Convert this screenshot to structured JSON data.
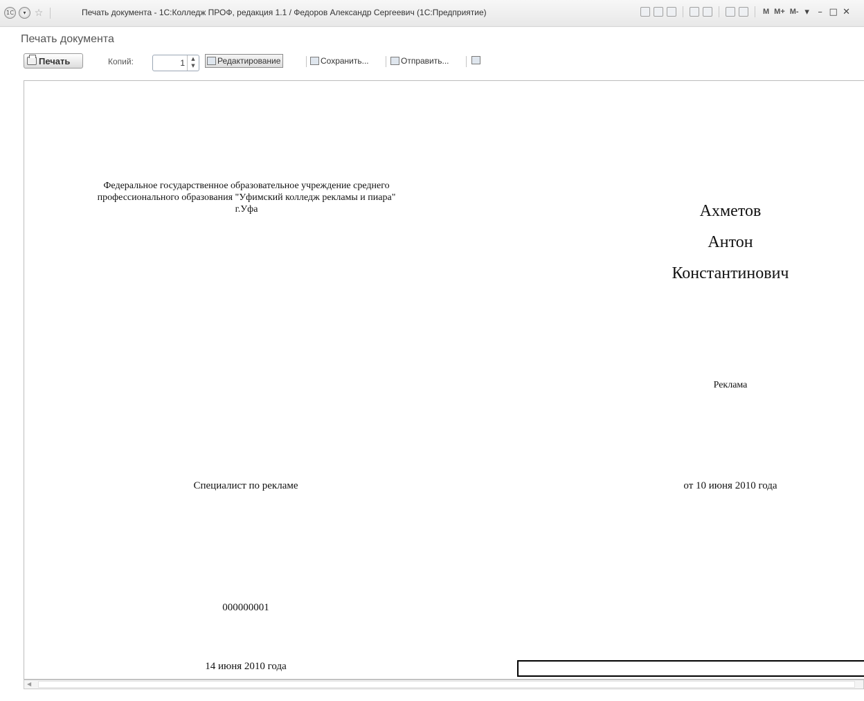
{
  "window": {
    "title": "Печать документа - 1С:Колледж ПРОФ, редакция 1.1 / Федоров Александр Сергеевич  (1С:Предприятие)",
    "app_icon": "1c-logo-icon",
    "menu_icon": "chevron-down-icon",
    "favorite_icon": "star-icon",
    "memory_buttons": [
      "M",
      "M+",
      "M-"
    ],
    "minimize": "–",
    "maximize": "□",
    "close": "✕"
  },
  "form": {
    "title": "Печать документа"
  },
  "toolbar": {
    "print_label": "Печать",
    "copies_label": "Копий:",
    "copies_value": "1",
    "edit_label": "Редактирование",
    "save_label": "Сохранить...",
    "send_label": "Отправить...",
    "preview_icon": "page-preview-icon"
  },
  "document": {
    "organization_line1": "Федеральное государственное образовательное учреждение среднего",
    "organization_line2": "профессионального образования \"Уфимский колледж рекламы и пиара\"",
    "organization_line3": "г.Уфа",
    "surname": "Ахметов",
    "name": "Антон",
    "patronymic": "Константинович",
    "specialty": "Реклама",
    "qualification": "Специалист по рекламе",
    "protocol_date": "от 10 июня 2010 года",
    "number": "000000001",
    "issue_date": "14 июня 2010 года"
  }
}
